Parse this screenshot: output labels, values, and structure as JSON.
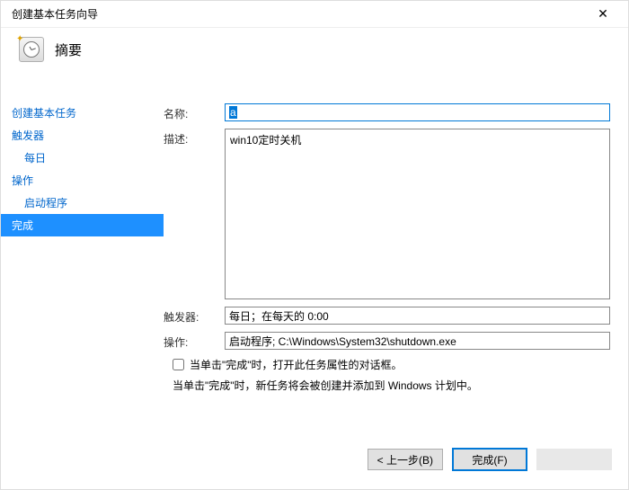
{
  "window": {
    "title": "创建基本任务向导"
  },
  "header": {
    "title": "摘要"
  },
  "sidebar": {
    "items": [
      {
        "label": "创建基本任务",
        "indent": 0,
        "selected": false
      },
      {
        "label": "触发器",
        "indent": 0,
        "selected": false
      },
      {
        "label": "每日",
        "indent": 1,
        "selected": false
      },
      {
        "label": "操作",
        "indent": 0,
        "selected": false
      },
      {
        "label": "启动程序",
        "indent": 1,
        "selected": false
      },
      {
        "label": "完成",
        "indent": 0,
        "selected": true
      }
    ]
  },
  "form": {
    "name_label": "名称:",
    "name_value": "a",
    "desc_label": "描述:",
    "desc_value": "win10定时关机",
    "trigger_label": "触发器:",
    "trigger_value": "每日；在每天的 0:00",
    "action_label": "操作:",
    "action_value": "启动程序; C:\\Windows\\System32\\shutdown.exe",
    "checkbox_label": "当单击\"完成\"时，打开此任务属性的对话框。",
    "info_text": "当单击\"完成\"时，新任务将会被创建并添加到 Windows 计划中。"
  },
  "footer": {
    "back": "< 上一步(B)",
    "finish": "完成(F)"
  }
}
